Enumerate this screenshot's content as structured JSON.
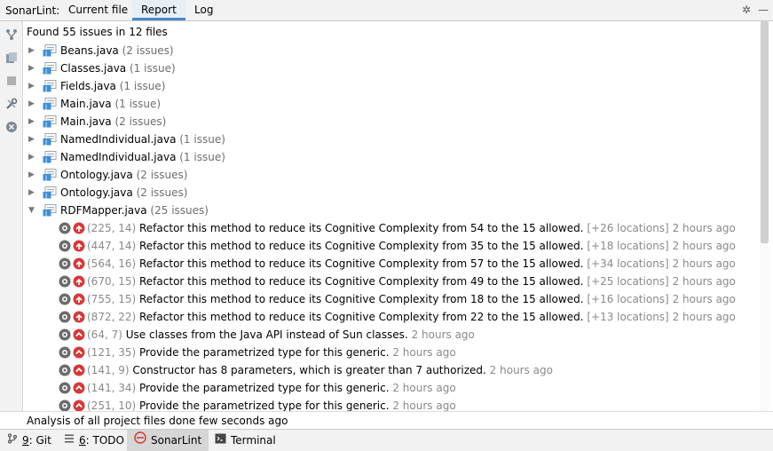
{
  "header": {
    "label": "SonarLint:",
    "tabs": [
      {
        "label": "Current file",
        "active": false
      },
      {
        "label": "Report",
        "active": true
      },
      {
        "label": "Log",
        "active": false
      }
    ],
    "settings_glyph": "✲",
    "minimize_glyph": "—"
  },
  "toolbar": {
    "icons": [
      "group-icon",
      "files-icon",
      "stop-icon",
      "tools-icon",
      "clear-icon"
    ]
  },
  "summary": "Found 55 issues in 12 files",
  "files": [
    {
      "name": "Beans.java",
      "count": "(2 issues)",
      "expanded": false
    },
    {
      "name": "Classes.java",
      "count": "(1 issue)",
      "expanded": false
    },
    {
      "name": "Fields.java",
      "count": "(1 issue)",
      "expanded": false
    },
    {
      "name": "Main.java",
      "count": "(1 issue)",
      "expanded": false
    },
    {
      "name": "Main.java",
      "count": "(2 issues)",
      "expanded": false
    },
    {
      "name": "NamedIndividual.java",
      "count": "(1 issue)",
      "expanded": false
    },
    {
      "name": "NamedIndividual.java",
      "count": "(1 issue)",
      "expanded": false
    },
    {
      "name": "Ontology.java",
      "count": "(2 issues)",
      "expanded": false
    },
    {
      "name": "Ontology.java",
      "count": "(2 issues)",
      "expanded": false
    },
    {
      "name": "RDFMapper.java",
      "count": "(25 issues)",
      "expanded": true
    }
  ],
  "issues": [
    {
      "loc": "(225, 14)",
      "msg": "Refactor this method to reduce its Cognitive Complexity from 54 to the 15 allowed.",
      "extra": "[+26 locations]",
      "time": "2 hours ago",
      "severity": "critical"
    },
    {
      "loc": "(447, 14)",
      "msg": "Refactor this method to reduce its Cognitive Complexity from 35 to the 15 allowed.",
      "extra": "[+18 locations]",
      "time": "2 hours ago",
      "severity": "critical"
    },
    {
      "loc": "(564, 16)",
      "msg": "Refactor this method to reduce its Cognitive Complexity from 57 to the 15 allowed.",
      "extra": "[+34 locations]",
      "time": "2 hours ago",
      "severity": "critical"
    },
    {
      "loc": "(670, 15)",
      "msg": "Refactor this method to reduce its Cognitive Complexity from 49 to the 15 allowed.",
      "extra": "[+25 locations]",
      "time": "2 hours ago",
      "severity": "critical"
    },
    {
      "loc": "(755, 15)",
      "msg": "Refactor this method to reduce its Cognitive Complexity from 18 to the 15 allowed.",
      "extra": "[+16 locations]",
      "time": "2 hours ago",
      "severity": "critical"
    },
    {
      "loc": "(872, 22)",
      "msg": "Refactor this method to reduce its Cognitive Complexity from 22 to the 15 allowed.",
      "extra": "[+13 locations]",
      "time": "2 hours ago",
      "severity": "critical"
    },
    {
      "loc": "(64, 7)",
      "msg": "Use classes from the Java API instead of Sun classes.",
      "extra": "",
      "time": "2 hours ago",
      "severity": "major"
    },
    {
      "loc": "(121, 35)",
      "msg": "Provide the parametrized type for this generic.",
      "extra": "",
      "time": "2 hours ago",
      "severity": "major"
    },
    {
      "loc": "(141, 9)",
      "msg": "Constructor has 8 parameters, which is greater than 7 authorized.",
      "extra": "",
      "time": "2 hours ago",
      "severity": "major"
    },
    {
      "loc": "(141, 34)",
      "msg": "Provide the parametrized type for this generic.",
      "extra": "",
      "time": "2 hours ago",
      "severity": "major"
    },
    {
      "loc": "(251, 10)",
      "msg": "Provide the parametrized type for this generic.",
      "extra": "",
      "time": "2 hours ago",
      "severity": "major"
    }
  ],
  "status": "Analysis of all project files done few seconds ago",
  "bottom_tabs": [
    {
      "num": "9",
      "label": ": Git",
      "icon": "git-branch-icon",
      "active": false
    },
    {
      "num": "6",
      "label": ": TODO",
      "icon": "todo-icon",
      "active": false
    },
    {
      "num": "",
      "label": "SonarLint",
      "icon": "sonarlint-icon",
      "active": true
    },
    {
      "num": "",
      "label": "Terminal",
      "icon": "terminal-icon",
      "active": false
    }
  ],
  "colors": {
    "accent": "#4a88c7",
    "severity_red": "#d33a3a",
    "muted": "#8a8a8a"
  }
}
